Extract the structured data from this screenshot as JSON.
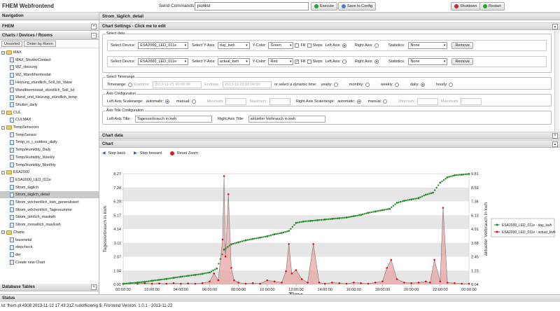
{
  "app": {
    "title": "FHEM Webfrontend"
  },
  "command": {
    "label": "Send Commands:",
    "value": "jsonlist",
    "execute": "Execute",
    "save": "Save to Config",
    "shutdown": "Shutdown",
    "restart": "Restart"
  },
  "left": {
    "nav_title": "Navigation",
    "fhem_title": "FHEM",
    "charts_title": "Charts / Devices / Rooms",
    "unsorted": "Unsorted",
    "order_by_room": "Order by Room",
    "db_tables": "Database Tables",
    "tree": [
      {
        "label": "MAX",
        "type": "folder",
        "level": 0
      },
      {
        "label": "MAX_ShutterContact",
        "type": "file",
        "level": 1
      },
      {
        "label": "WZ_Heizung",
        "type": "file",
        "level": 1
      },
      {
        "label": "WZ_Wandthermostat",
        "type": "file",
        "level": 1
      },
      {
        "label": "Heizung_stündlich_Soll_Ist_Valve",
        "type": "file",
        "level": 1
      },
      {
        "label": "Wandthermostat_stündlich_Soll_Ist",
        "type": "file",
        "level": 1
      },
      {
        "label": "Wand_und_Heizung_stündlich_temp",
        "type": "file",
        "level": 1
      },
      {
        "label": "Shutter_daily",
        "type": "file",
        "level": 1
      },
      {
        "label": "CUL",
        "type": "folder",
        "level": 0
      },
      {
        "label": "CULMAX",
        "type": "file",
        "level": 1
      },
      {
        "label": "TempSensoren",
        "type": "folder",
        "level": 0
      },
      {
        "label": "TempSensor",
        "type": "file",
        "level": 1
      },
      {
        "label": "Temp_in_i_outdoor_daily",
        "type": "file",
        "level": 1
      },
      {
        "label": "Temp/Humidity_Daily",
        "type": "file",
        "level": 1
      },
      {
        "label": "Temp/Humidity_Weekly",
        "type": "file",
        "level": 1
      },
      {
        "label": "Temp/Humidity_Monthly",
        "type": "file",
        "level": 1
      },
      {
        "label": "ESA2000",
        "type": "folder",
        "level": 0
      },
      {
        "label": "ESA2000_LED_011e",
        "type": "file",
        "level": 1
      },
      {
        "label": "Strom_täglich",
        "type": "file",
        "level": 1
      },
      {
        "label": "Strom_täglich_detail",
        "type": "file",
        "level": 1,
        "selected": true
      },
      {
        "label": "Strom_wöchentlich_kwh_generalisiert",
        "type": "file",
        "level": 1
      },
      {
        "label": "Strom_wöchentlich_Tagessumme",
        "type": "file",
        "level": 1
      },
      {
        "label": "Strom_jährlich_maxkwh",
        "type": "file",
        "level": 1
      },
      {
        "label": "Strom_monatlich_max/kwh",
        "type": "file",
        "level": 1
      },
      {
        "label": "Charts",
        "type": "folder",
        "level": 0
      },
      {
        "label": "basenetal",
        "type": "file",
        "level": 1
      },
      {
        "label": "stepcheck",
        "type": "file",
        "level": 1
      },
      {
        "label": "der",
        "type": "file",
        "level": 1
      },
      {
        "label": "Create new Chart",
        "type": "file",
        "level": 1
      }
    ]
  },
  "main": {
    "title": "Strom_täglich_detail",
    "settings_title": "Chart Settings - Click me to edit",
    "select_data_legend": "Select data",
    "rows": [
      {
        "device_label": "Select Device:",
        "device": "ESA2000_LED_011e",
        "yaxis_label": "Select Y-Axis:",
        "yaxis": "day_kwh",
        "color_label": "Y-Color:",
        "color": "Green",
        "fill_label": "Fill",
        "fill": false,
        "steps_label": "Steps",
        "left_axis": "Left Axis:",
        "right_axis": "Right Axis:",
        "left_on": true,
        "stats_label": "Statistics:",
        "stats": "None",
        "remove": "Remove"
      },
      {
        "device_label": "Select Device:",
        "device": "ESA2000_LED_011e",
        "yaxis_label": "Select Y-Axis:",
        "yaxis": "actual_kwh",
        "color_label": "Y-Color:",
        "color": "Red",
        "fill_label": "Fill",
        "fill": true,
        "steps_label": "Steps",
        "left_axis": "Left Axis:",
        "right_axis": "Right Axis:",
        "left_on": false,
        "stats_label": "Statistics:",
        "stats": "None",
        "remove": "Remove"
      }
    ],
    "timerange_legend": "Select Timerange",
    "timerange_label": "Timerange:",
    "starttime_label": "Starttime:",
    "starttime": "2013-11-21 00:00:00",
    "endtime_label": "Endtime:",
    "endtime": "2013-11-22 00:00:00",
    "dynamic_label": "or select a dynamic time:",
    "dyn": [
      "yearly:",
      "monthly:",
      "weekly:",
      "daily:",
      "hourly:"
    ],
    "axis_legend": "Axis Configuration",
    "left_scale": "Left Axis Scalerange:",
    "right_scale": "Right Axis Scalerange:",
    "automatic": "automatic:",
    "manual": "manual:",
    "minimum": "Minimum:",
    "maximum": "Maximum:",
    "title_legend": "Axis Title Configuration",
    "left_title_label": "Left Axis Title:",
    "left_title": "Tagesverbrauch in kwh",
    "right_title_label": "Right Axis Title:",
    "right_title": "aktueller Verbrauch in kwh",
    "chart_data_title": "Chart data",
    "chart_title": "Chart",
    "step_back": "Step back",
    "step_forward": "Step forward",
    "reset_zoom": "Reset Zoom"
  },
  "status": {
    "title": "Status",
    "footer": "Id: fhem.pl 4308 2013-11-12 17:43:31Z rudolfkoenig $; Frontend Version: 1.0.1 - 2013-11-22"
  },
  "colors": {
    "green": "#1f8a1f",
    "red": "#dd1111",
    "fill": "#e8a0a0"
  },
  "chart_data": {
    "type": "line",
    "xlabel": "Time",
    "ylabel_left": "Tagesverbrauch in kwh",
    "ylabel_right": "aktueller Verbrauch in kwh",
    "left_ticks": [
      "8.27",
      "7.24",
      "6.20",
      "5.17",
      "4.14",
      "3.11",
      "2.07",
      "1.04",
      "0.01"
    ],
    "right_ticks": [
      "9.81",
      "8.59",
      "7.36",
      "6.13",
      "4.91",
      "3.68",
      "2.45",
      "1.23",
      "0.04"
    ],
    "x_ticks": [
      "00:00:00",
      "02:00:00",
      "04:00:00",
      "06:00:00",
      "08:00:00",
      "10:00:00",
      "12:00:00",
      "14:00:00",
      "16:00:00",
      "18:00:00",
      "20:00:00",
      "22:00:00",
      "00:00:00"
    ],
    "ylim_left": [
      0.01,
      8.27
    ],
    "ylim_right": [
      0.04,
      9.81
    ],
    "legend": "right",
    "series": [
      {
        "name": "ESA2000_LED_011e - day_kwh",
        "color": "#1f8a1f",
        "axis": "left",
        "x": [
          0,
          0.5,
          1,
          1.5,
          2,
          2.5,
          3,
          3.5,
          4,
          4.5,
          5,
          5.5,
          6,
          6.5,
          7,
          7.5,
          8,
          8.5,
          9,
          9.5,
          10,
          10.5,
          11,
          11.5,
          12,
          12.5,
          13,
          13.5,
          14,
          14.5,
          15,
          15.5,
          16,
          16.5,
          17,
          17.5,
          18,
          18.5,
          19,
          19.5,
          20,
          20.5,
          21,
          21.5,
          22,
          22.5,
          23,
          23.5,
          24
        ],
        "y": [
          0.05,
          0.1,
          0.15,
          0.2,
          0.28,
          0.35,
          0.42,
          0.5,
          0.58,
          0.65,
          0.72,
          0.8,
          0.9,
          1.2,
          2.6,
          3.0,
          3.15,
          3.3,
          3.4,
          3.5,
          3.6,
          3.75,
          3.85,
          4.0,
          4.6,
          4.7,
          4.75,
          4.8,
          4.85,
          4.9,
          4.95,
          5.0,
          5.1,
          5.2,
          5.35,
          5.45,
          5.55,
          5.65,
          6.1,
          6.25,
          6.35,
          6.45,
          6.7,
          6.85,
          7.6,
          8.0,
          8.15,
          8.2,
          8.25
        ]
      },
      {
        "name": "ESA2000_LED_011e - actual_kwh",
        "color": "#dd1111",
        "axis": "right",
        "x": [
          0,
          0.5,
          1,
          1.5,
          2,
          2.5,
          3,
          3.5,
          4,
          4.5,
          5,
          5.5,
          6,
          6.3,
          6.6,
          6.9,
          7.0,
          7.1,
          7.3,
          7.5,
          7.7,
          8,
          8.5,
          9,
          9.5,
          10,
          10.5,
          11,
          11.3,
          11.5,
          11.7,
          12,
          12.4,
          12.8,
          13.2,
          13.6,
          14,
          14.5,
          15,
          15.5,
          16,
          16.5,
          17,
          17.5,
          18,
          18.3,
          18.6,
          19,
          19.5,
          20,
          20.5,
          21,
          21.3,
          21.6,
          22,
          22.2,
          22.5,
          23,
          23.5,
          24
        ],
        "y": [
          0.1,
          0.15,
          0.1,
          0.15,
          0.1,
          0.12,
          0.1,
          0.15,
          0.1,
          0.12,
          0.1,
          0.15,
          0.3,
          1.0,
          0.4,
          4.0,
          9.6,
          2.5,
          8.0,
          1.5,
          0.4,
          0.2,
          0.1,
          0.15,
          0.1,
          0.4,
          0.3,
          0.2,
          1.2,
          3.6,
          1.0,
          1.3,
          0.5,
          0.2,
          3.6,
          0.2,
          0.1,
          0.2,
          0.15,
          0.1,
          0.2,
          0.15,
          0.1,
          0.2,
          0.3,
          1.5,
          2.2,
          0.5,
          0.2,
          0.15,
          0.2,
          0.3,
          0.2,
          2.2,
          0.3,
          6.8,
          0.2,
          0.15,
          0.1,
          0.1
        ]
      }
    ]
  }
}
